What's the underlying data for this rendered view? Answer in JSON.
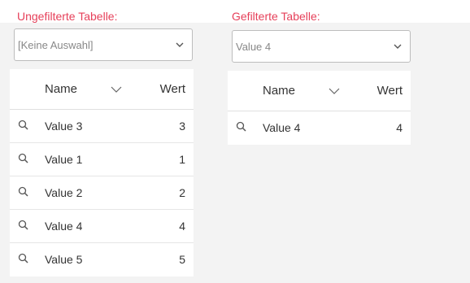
{
  "colors": {
    "title": "#e6405a",
    "page_bg": "#f3f3f3",
    "card_bg": "#ffffff"
  },
  "unfiltered": {
    "title": "Ungefilterte Tabelle:",
    "select_value": "[Keine Auswahl]",
    "columns": {
      "name": "Name",
      "value": "Wert"
    },
    "rows": [
      {
        "name": "Value 3",
        "value": "3"
      },
      {
        "name": "Value 1",
        "value": "1"
      },
      {
        "name": "Value 2",
        "value": "2"
      },
      {
        "name": "Value 4",
        "value": "4"
      },
      {
        "name": "Value 5",
        "value": "5"
      }
    ]
  },
  "filtered": {
    "title": "Gefilterte Tabelle:",
    "select_value": "Value 4",
    "columns": {
      "name": "Name",
      "value": "Wert"
    },
    "rows": [
      {
        "name": "Value 4",
        "value": "4"
      }
    ]
  },
  "icons": {
    "row_action": "magnifier-icon",
    "sort": "chevron-down-icon",
    "dropdown": "chevron-down-icon"
  }
}
